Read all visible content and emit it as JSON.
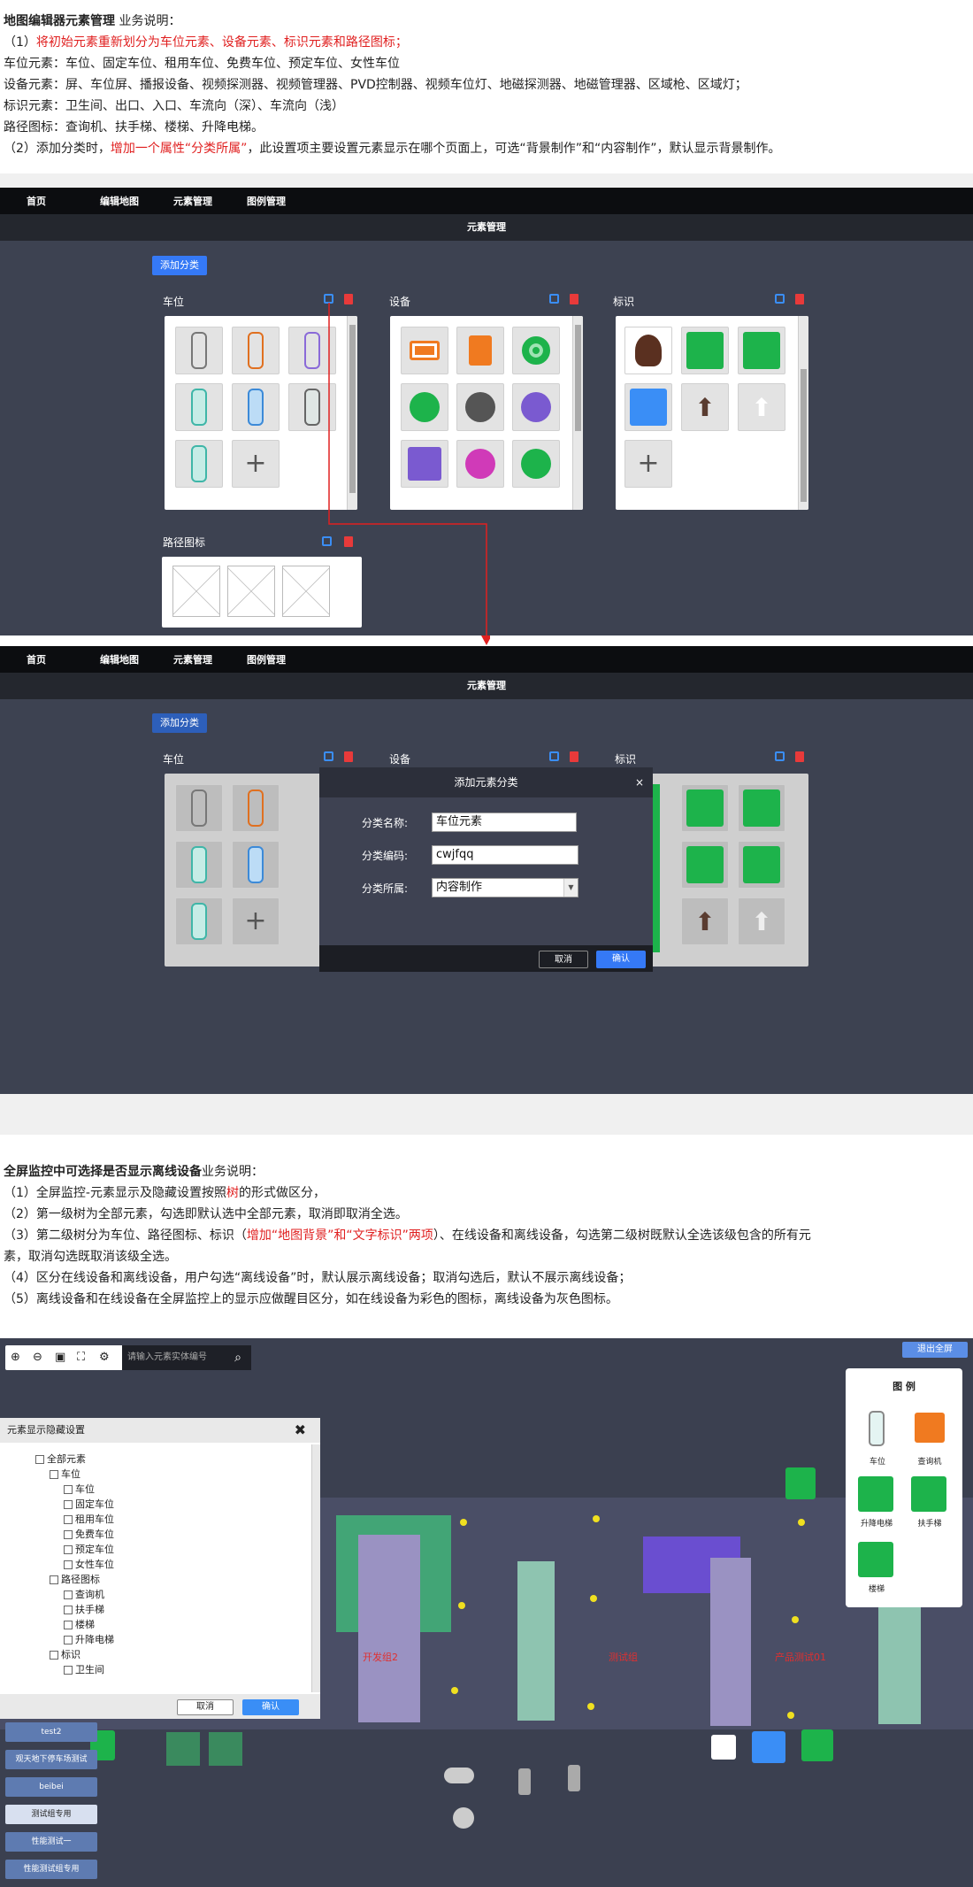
{
  "sec1": {
    "title": "地图编辑器元素管理",
    "title_tail": " 业务说明：",
    "l1_pre": "（1）",
    "l1_red": "将初始元素重新划分为车位元素、设备元素、标识元素和路径图标；",
    "l2": "车位元素：车位、固定车位、租用车位、免费车位、预定车位、女性车位",
    "l3": "设备元素：屏、车位屏、播报设备、视频探测器、视频管理器、PVD控制器、视频车位灯、地磁探测器、地磁管理器、区域枪、区域灯；",
    "l4": "标识元素：卫生间、出口、入口、车流向（深）、车流向（浅）",
    "l5": "路径图标：查询机、扶手梯、楼梯、升降电梯。",
    "l6_pre": "（2）添加分类时，",
    "l6_red": "增加一个属性“分类所属”",
    "l6_post": "，此设置项主要设置元素显示在哪个页面上，可选“背景制作”和“内容制作”，默认显示背景制作。"
  },
  "nav": {
    "items": [
      "首页",
      "编辑地图",
      "元素管理",
      "图例管理"
    ],
    "page_title": "元素管理",
    "add_btn": "添加分类"
  },
  "sections": {
    "parking": "车位",
    "device": "设备",
    "sign": "标识",
    "path": "路径图标"
  },
  "dialog": {
    "title": "添加元素分类",
    "close": "×",
    "name_label": "分类名称:",
    "name_value": "车位元素",
    "code_label": "分类编码:",
    "code_value": "cwjfqq",
    "belong_label": "分类所属:",
    "belong_value": "内容制作",
    "cancel": "取消",
    "ok": "确认"
  },
  "sec2": {
    "title": "全屏监控中可选择是否显示离线设备",
    "title_tail": "业务说明：",
    "l1_pre": "（1）全屏监控-元素显示及隐藏设置按照",
    "l1_red": "树",
    "l1_post": "的形式做区分，",
    "l2": "（2）第一级树为全部元素，勾选即默认选中全部元素，取消即取消全选。",
    "l3_pre": "（3）第二级树分为车位、路径图标、标识（",
    "l3_red": "增加“地图背景”和“文字标识”两项",
    "l3_post": "）、在线设备和离线设备，勾选第二级树既默认全选该级包含的所有元",
    "l3b": "素，取消勾选既取消该级全选。",
    "l4": "（4）区分在线设备和离线设备，用户勾选“离线设备”时，默认展示离线设备；取消勾选后，默认不展示离线设备；",
    "l5": "（5）离线设备和在线设备在全屏监控上的显示应做醒目区分，如在线设备为彩色的图标，离线设备为灰色图标。"
  },
  "monitor": {
    "search_placeholder": "请输入元素实体编号",
    "exit_btn": "退出全屏",
    "legend_title": "图 例",
    "legend_items": [
      "车位",
      "查询机",
      "升降电梯",
      "扶手梯",
      "楼梯"
    ],
    "panel_title": "元素显示隐藏设置",
    "panel_close": "✖",
    "tree": [
      "全部元素",
      "车位",
      "车位",
      "固定车位",
      "租用车位",
      "免费车位",
      "预定车位",
      "女性车位",
      "路径图标",
      "查询机",
      "扶手梯",
      "楼梯",
      "升降电梯",
      "标识",
      "卫生间"
    ],
    "cancel": "取消",
    "ok": "确认",
    "map_labels": [
      "开发组2",
      "测试组",
      "产品测试01"
    ],
    "left_btns": [
      "test2",
      "观天地下停车场测试",
      "beibei",
      "测试组专用",
      "性能测试一",
      "性能测试组专用"
    ]
  },
  "colors": {
    "accent": "#3579f6",
    "red": "#e02020",
    "green": "#1db34b"
  }
}
